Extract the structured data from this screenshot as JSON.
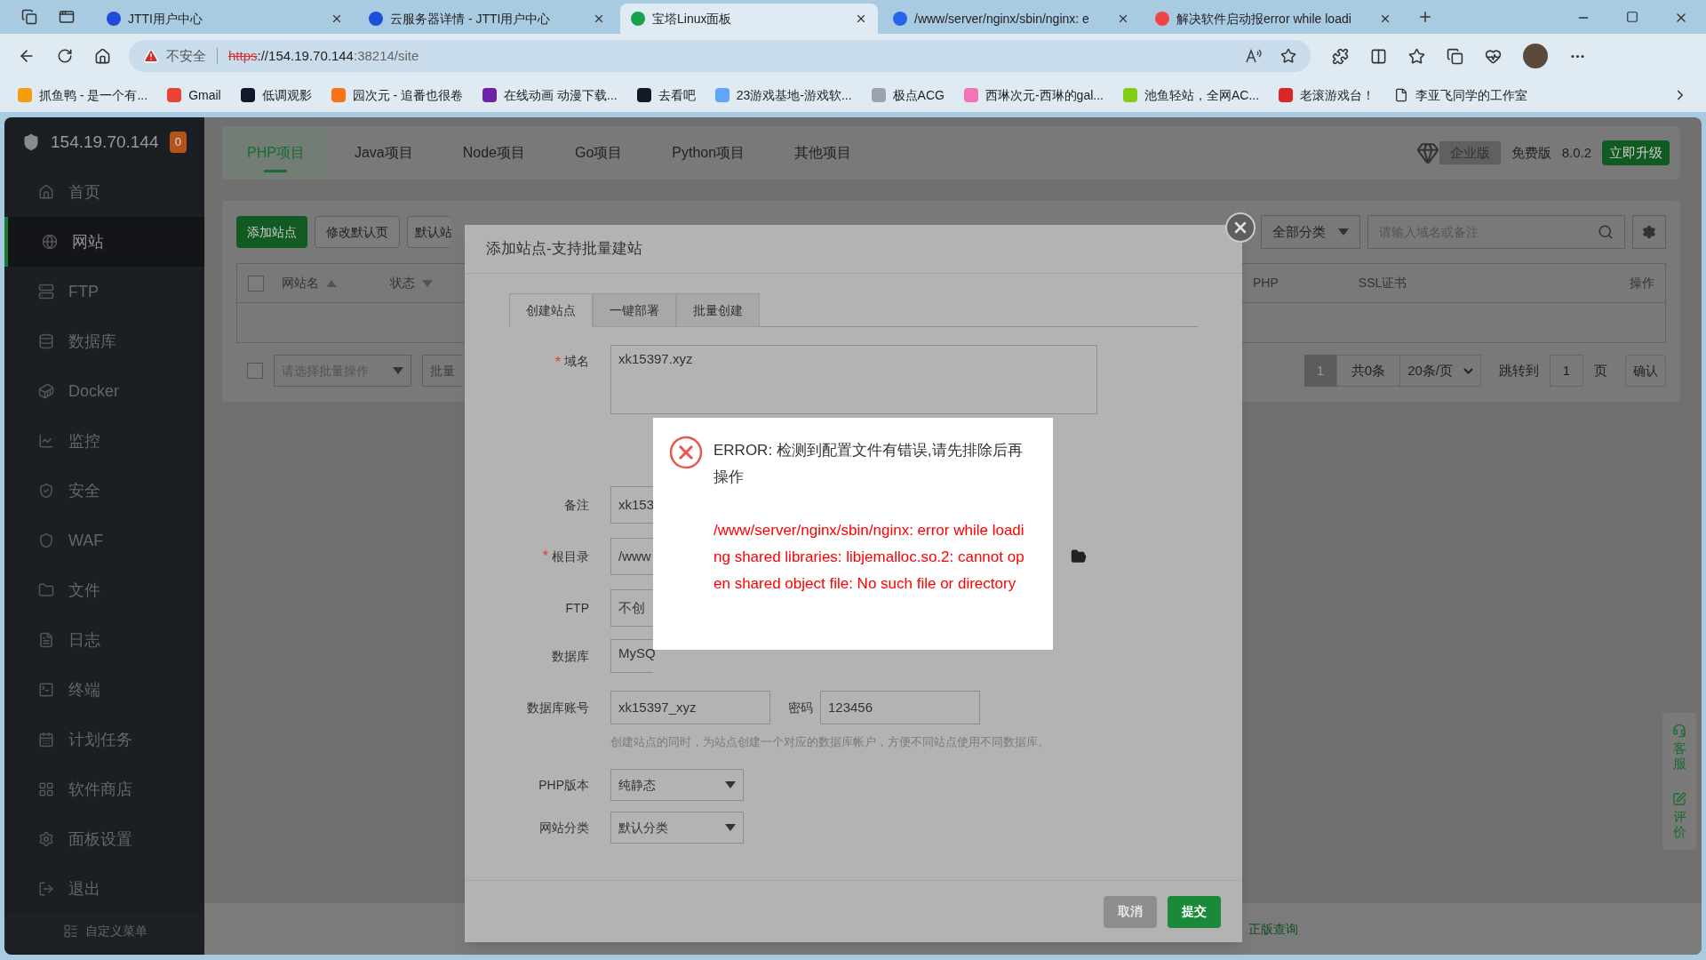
{
  "browser": {
    "tabs": [
      {
        "title": "JTTI用户中心",
        "selected": false
      },
      {
        "title": "云服务器详情 - JTTI用户中心",
        "selected": false
      },
      {
        "title": "宝塔Linux面板",
        "selected": true
      },
      {
        "title": "/www/server/nginx/sbin/nginx: e",
        "selected": false
      },
      {
        "title": "解决软件启动报error while loadi",
        "selected": false
      }
    ],
    "security": "不安全",
    "scheme": "https",
    "host": "://154.19.70.144",
    "path": ":38214/site",
    "bookmarks": [
      "抓鱼鸭 - 是一个有...",
      "Gmail",
      "低调观影",
      "园次元 - 追番也很卷",
      "在线动画 动漫下载...",
      "去看吧",
      "23游戏基地-游戏软...",
      "极点ACG",
      "西琳次元-西琳的gal...",
      "池鱼轻站，全网AC...",
      "老滚游戏台！",
      "李亚飞同学的工作室"
    ]
  },
  "sidebar": {
    "host": "154.19.70.144",
    "badge": "0",
    "items": [
      {
        "label": "首页",
        "selected": false
      },
      {
        "label": "网站",
        "selected": true
      },
      {
        "label": "FTP",
        "selected": false
      },
      {
        "label": "数据库",
        "selected": false
      },
      {
        "label": "Docker",
        "selected": false
      },
      {
        "label": "监控",
        "selected": false
      },
      {
        "label": "安全",
        "selected": false
      },
      {
        "label": "WAF",
        "selected": false
      },
      {
        "label": "文件",
        "selected": false
      },
      {
        "label": "日志",
        "selected": false
      },
      {
        "label": "终端",
        "selected": false
      },
      {
        "label": "计划任务",
        "selected": false
      },
      {
        "label": "软件商店",
        "selected": false
      },
      {
        "label": "面板设置",
        "selected": false
      },
      {
        "label": "退出",
        "selected": false
      }
    ],
    "custom_menu": "自定义菜单"
  },
  "header": {
    "tabs": [
      {
        "label": "PHP项目",
        "selected": true
      },
      {
        "label": "Java项目",
        "selected": false
      },
      {
        "label": "Node项目",
        "selected": false
      },
      {
        "label": "Go项目",
        "selected": false
      },
      {
        "label": "Python项目",
        "selected": false
      },
      {
        "label": "其他项目",
        "selected": false
      }
    ],
    "edition": "企业版",
    "plan": "免费版",
    "version": "8.0.2",
    "upgrade": "立即升级"
  },
  "toolbar": {
    "buttons": [
      "添加站点",
      "修改默认页",
      "默认站"
    ],
    "category": "全部分类",
    "search_placeholder": "请输入域名或备注"
  },
  "table": {
    "select_all_checked": false,
    "columns": [
      "网站名",
      "状态",
      "PHP",
      "SSL证书",
      "操作"
    ]
  },
  "footer": {
    "row_checked": false,
    "batch_placeholder": "请选择批量操作",
    "batch_button": "批量",
    "current_page": "1",
    "total": "共0条",
    "per_page": "20条/页",
    "jump_label": "跳转到",
    "jump_value": "1",
    "page_unit": "页",
    "confirm": "确认"
  },
  "side_widget": [
    "客服",
    "评价"
  ],
  "bottom_link": "正版查询",
  "dialog": {
    "title": "添加站点-支持批量建站",
    "tabs": [
      {
        "label": "创建站点",
        "selected": true
      },
      {
        "label": "一键部署",
        "selected": false
      },
      {
        "label": "批量创建",
        "selected": false
      }
    ],
    "required_mark": "*",
    "domain": {
      "label": "域名",
      "required": true,
      "value": "xk15397.xyz"
    },
    "remark": {
      "label": "备注",
      "required": false,
      "value": "xk153"
    },
    "root": {
      "label": "根目录",
      "required": true,
      "value": "/www"
    },
    "ftp": {
      "label": "FTP",
      "required": false,
      "value": "不创"
    },
    "database": {
      "label": "数据库",
      "required": false,
      "value": "MySQ"
    },
    "db_account": {
      "label": "数据库账号",
      "value": "xk15397_xyz"
    },
    "password": {
      "label": "密码",
      "value": "123456"
    },
    "hint": "创建站点的同时，为站点创建一个对应的数据库帐户，方便不同站点使用不同数据库。",
    "php_version": {
      "label": "PHP版本",
      "value": "纯静态"
    },
    "site_category": {
      "label": "网站分类",
      "value": "默认分类"
    },
    "cancel": {
      "label": "取消",
      "disabled": true
    },
    "submit": {
      "label": "提交",
      "disabled": false
    }
  },
  "error": {
    "title": "ERROR: 检测到配置文件有错误,请先排除后再操作",
    "detail": "/www/server/nginx/sbin/nginx: error while loading shared libraries: libjemalloc.so.2: cannot open shared object file: No such file or directory"
  }
}
